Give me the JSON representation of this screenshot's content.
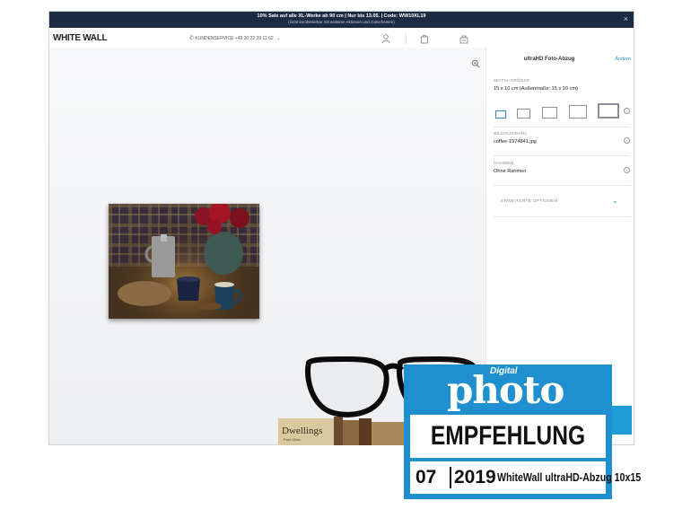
{
  "banner": {
    "line1": "10% Sale auf alle XL-Werke ab 90 cm | Nur bis 13.05. | Code: WW10XL19",
    "line2": "(nicht kombinierbar mit anderen Aktionen und Gutscheinen)",
    "close": "×"
  },
  "header": {
    "logo": "WHITE WALL",
    "service": "KUNDENSERVICE +49 30 22 39 11 62",
    "icons": [
      "user-icon",
      "bag-icon",
      "cart-icon"
    ]
  },
  "panel": {
    "title": "ultraHD Foto-Abzug",
    "change": "Ändern",
    "size_label": "MOTIV-GRÖSSE",
    "size_value": "15 x 10 cm (Außenmaße: 15 x 10 cm)",
    "image_label": "BILDAUSWAHL",
    "image_value": "coffee-1974841.jpg",
    "frame_label": "RAHMEN",
    "frame_value": "Ohne Rahmen",
    "advanced": "ERWEITERTE OPTIONEN"
  },
  "book": {
    "title": "Dwellings",
    "author": "Paul Oliver"
  },
  "badge": {
    "brand_small": "Digital",
    "brand": "photo",
    "recommendation": "EMPFEHLUNG",
    "issue_month": "07",
    "issue_year": "2019",
    "product": "WhiteWall ultraHD-Abzug 10x15"
  },
  "colors": {
    "banner_bg": "#1d2a44",
    "accent": "#2a88c8",
    "badge_blue": "#1f8fd0"
  }
}
